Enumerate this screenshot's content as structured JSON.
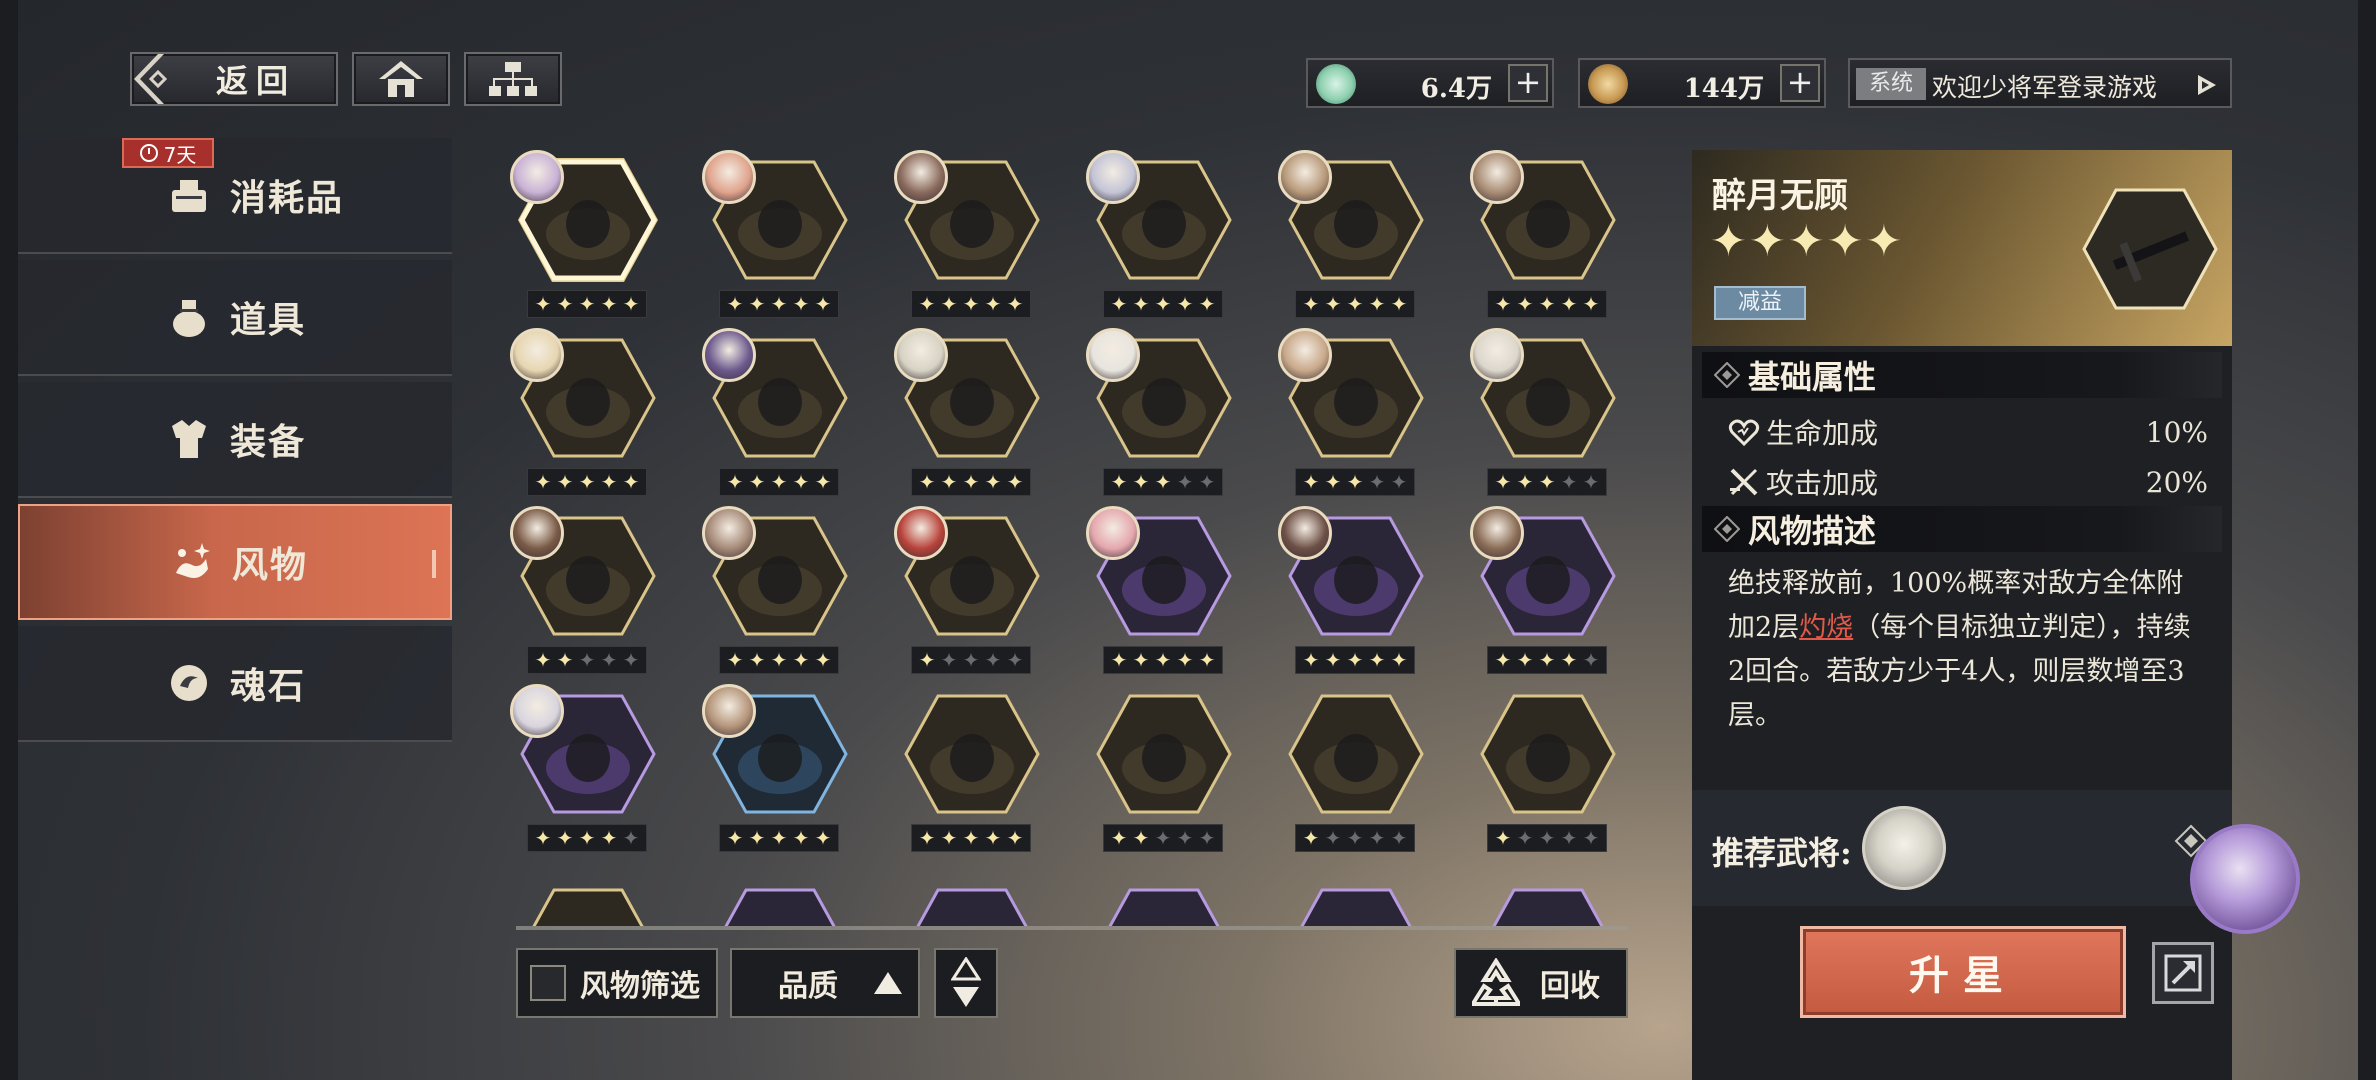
{
  "topbar": {
    "back_label": "返回",
    "home_icon": "home-icon",
    "map_icon": "hierarchy-icon",
    "currency1": {
      "icon": "jade-coin-icon",
      "value": "6.4万",
      "color": "#8fd0b0"
    },
    "currency2": {
      "icon": "copper-coin-icon",
      "value": "144万",
      "color": "#c89a54"
    },
    "system": {
      "tag": "系统",
      "message": "欢迎少将军登录游戏"
    }
  },
  "sidebar": {
    "badge": "7天",
    "items": [
      {
        "label": "消耗品",
        "icon": "consumable-icon",
        "active": false
      },
      {
        "label": "道具",
        "icon": "pouch-icon",
        "active": false
      },
      {
        "label": "装备",
        "icon": "armor-icon",
        "active": false
      },
      {
        "label": "风物",
        "icon": "artifact-icon",
        "active": true
      },
      {
        "label": "魂石",
        "icon": "soulstone-icon",
        "active": false
      }
    ]
  },
  "grid": {
    "rows": [
      [
        {
          "stars": 5,
          "frame": "gold",
          "selected": true,
          "avatar": "#c9b2d6"
        },
        {
          "stars": 5,
          "frame": "gold",
          "avatar": "#e0a38c"
        },
        {
          "stars": 5,
          "frame": "gold",
          "avatar": "#8a6a5c"
        },
        {
          "stars": 5,
          "frame": "gold",
          "avatar": "#c3c4d6"
        },
        {
          "stars": 5,
          "frame": "gold",
          "avatar": "#b89a7a"
        },
        {
          "stars": 5,
          "frame": "gold",
          "avatar": "#a98c74"
        }
      ],
      [
        {
          "stars": 5,
          "frame": "gold",
          "avatar": "#e7d6b0"
        },
        {
          "stars": 5,
          "frame": "gold",
          "avatar": "#6c5a8e"
        },
        {
          "stars": 5,
          "frame": "gold",
          "avatar": "#d7d3c4"
        },
        {
          "stars": 3,
          "frame": "gold",
          "avatar": "#e8e5de"
        },
        {
          "stars": 3,
          "frame": "gold",
          "avatar": "#c9a88a"
        },
        {
          "stars": 3,
          "frame": "gold",
          "avatar": "#dcd7cc"
        }
      ],
      [
        {
          "stars": 2,
          "frame": "gold",
          "avatar": "#7a5a46"
        },
        {
          "stars": 5,
          "frame": "gold",
          "avatar": "#a68a78"
        },
        {
          "stars": 1,
          "frame": "gold",
          "avatar": "#b8433a"
        },
        {
          "stars": 5,
          "frame": "purple",
          "avatar": "#e5a7ae"
        },
        {
          "stars": 5,
          "frame": "purple",
          "avatar": "#6d5046"
        },
        {
          "stars": 4,
          "frame": "purple",
          "avatar": "#8a6c56"
        }
      ],
      [
        {
          "stars": 4,
          "frame": "purple",
          "avatar": "#d9d5de"
        },
        {
          "stars": 5,
          "frame": "blue",
          "avatar": "#b5957a"
        },
        {
          "stars": 5,
          "frame": "gold",
          "avatar": ""
        },
        {
          "stars": 2,
          "frame": "gold",
          "avatar": ""
        },
        {
          "stars": 1,
          "frame": "gold",
          "avatar": ""
        },
        {
          "stars": 1,
          "frame": "gold",
          "avatar": ""
        }
      ],
      [
        {
          "stars": 0,
          "frame": "gold",
          "avatar": ""
        },
        {
          "stars": 0,
          "frame": "purple",
          "avatar": ""
        },
        {
          "stars": 0,
          "frame": "purple",
          "avatar": ""
        },
        {
          "stars": 0,
          "frame": "purple",
          "avatar": ""
        },
        {
          "stars": 0,
          "frame": "purple",
          "avatar": ""
        },
        {
          "stars": 0,
          "frame": "purple",
          "avatar": ""
        }
      ]
    ]
  },
  "controls": {
    "filter_label": "风物筛选",
    "quality_label": "品质",
    "recycle_label": "回收"
  },
  "detail": {
    "name": "醉月无顾",
    "stars": "✦✦✦✦✦",
    "tag": "减益",
    "section_attrs": "基础属性",
    "attrs": [
      {
        "label": "生命加成",
        "value": "10%",
        "icon": "heart-icon"
      },
      {
        "label": "攻击加成",
        "value": "20%",
        "icon": "crossed-swords-icon"
      }
    ],
    "section_desc": "风物描述",
    "desc_before": "绝技释放前，100%概率对敌方全体附加2层",
    "desc_keyword": "灼烧",
    "desc_after": "（每个目标独立判定），持续2回合。若敌方少于4人，则层数增至3层。",
    "recommend_label": "推荐武将:",
    "upgrade_label": "升星"
  }
}
